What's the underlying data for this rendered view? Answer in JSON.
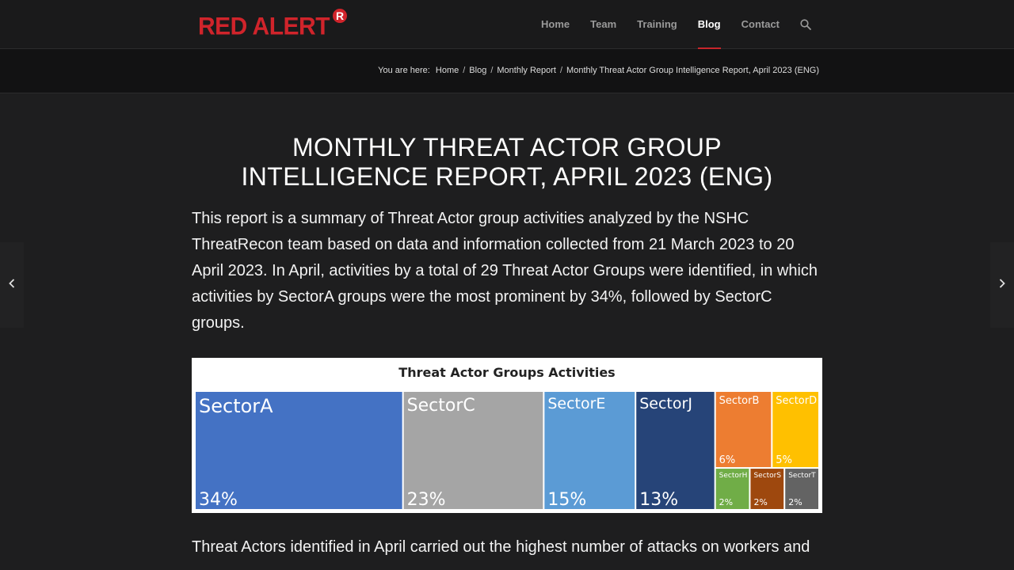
{
  "header": {
    "logo_text": "RED ALERT",
    "logo_badge": "R",
    "nav": [
      "Home",
      "Team",
      "Training",
      "Blog",
      "Contact"
    ],
    "active_nav": "Blog"
  },
  "breadcrumb": {
    "label": "You are here:",
    "items": [
      "Home",
      "Blog",
      "Monthly Report",
      "Monthly Threat Actor Group Intelligence Report, April 2023 (ENG)"
    ]
  },
  "article": {
    "title_line1": "MONTHLY THREAT ACTOR GROUP",
    "title_line2": "INTELLIGENCE REPORT, APRIL 2023 (ENG)",
    "intro": "This report is a summary of Threat Actor group activities analyzed by the NSHC ThreatRecon team based on data and information collected from 21 March 2023 to 20 April 2023. In April, activities by a total of 29 Threat Actor Groups were identified, in which activities by SectorA groups were the most prominent by 34%, followed by SectorC groups.",
    "bottom_text": "Threat Actors identified in April carried out the highest number of attacks on workers and"
  },
  "colors": {
    "brand_red": "#d0242b",
    "SectorA": "#4472c4",
    "SectorC": "#a5a5a5",
    "SectorE": "#5b9bd5",
    "SectorJ": "#264478",
    "SectorB": "#ed7d31",
    "SectorD": "#ffc000",
    "SectorH": "#70ad47",
    "SectorS": "#9e480e",
    "SectorT": "#636363"
  },
  "chart_data": {
    "type": "treemap",
    "title": "Threat Actor Groups Activities",
    "items": [
      {
        "name": "SectorA",
        "value": 34,
        "label": "34%"
      },
      {
        "name": "SectorC",
        "value": 23,
        "label": "23%"
      },
      {
        "name": "SectorE",
        "value": 15,
        "label": "15%"
      },
      {
        "name": "SectorJ",
        "value": 13,
        "label": "13%"
      },
      {
        "name": "SectorB",
        "value": 6,
        "label": "6%"
      },
      {
        "name": "SectorD",
        "value": 5,
        "label": "5%"
      },
      {
        "name": "SectorH",
        "value": 2,
        "label": "2%"
      },
      {
        "name": "SectorS",
        "value": 2,
        "label": "2%"
      },
      {
        "name": "SectorT",
        "value": 2,
        "label": "2%"
      }
    ]
  }
}
